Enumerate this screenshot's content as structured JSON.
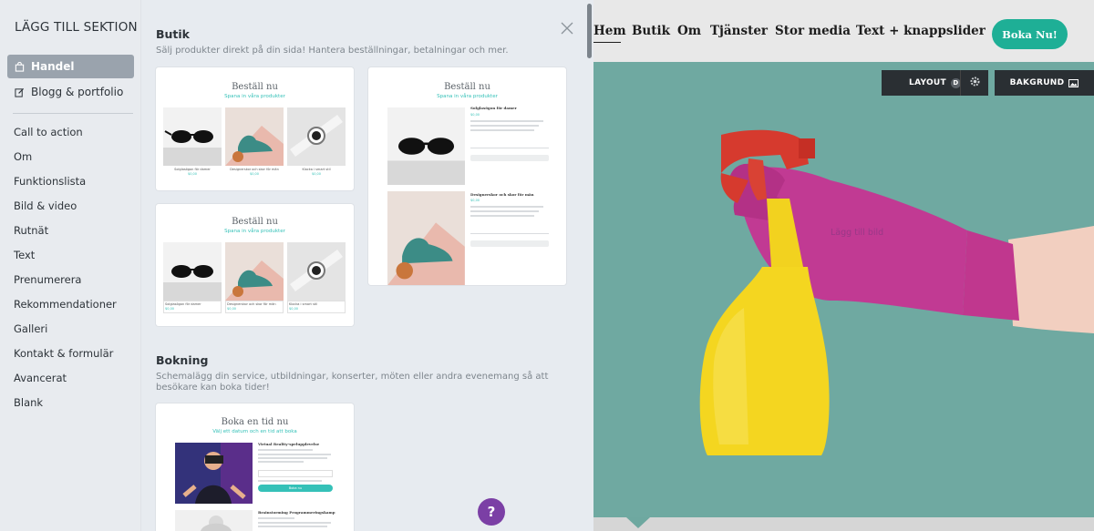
{
  "sidebar": {
    "title": "LÄGG TILL SEKTION",
    "categories": [
      {
        "label": "Handel",
        "icon": "shopping-bag-icon",
        "active": true
      },
      {
        "label": "Blogg & portfolio",
        "icon": "edit-icon",
        "active": false
      }
    ],
    "items": [
      {
        "label": "Call to action"
      },
      {
        "label": "Om"
      },
      {
        "label": "Funktionslista"
      },
      {
        "label": "Bild & video"
      },
      {
        "label": "Rutnät"
      },
      {
        "label": "Text"
      },
      {
        "label": "Prenumerera"
      },
      {
        "label": "Rekommendationer"
      },
      {
        "label": "Galleri"
      },
      {
        "label": "Kontakt & formulär"
      },
      {
        "label": "Avancerat"
      },
      {
        "label": "Blank"
      }
    ]
  },
  "panel": {
    "close_icon": "close-icon",
    "sections": [
      {
        "title": "Butik",
        "description": "Sälj produkter direkt på din sida! Hantera beställningar, betalningar och mer.",
        "templates": [
          {
            "title": "Beställ nu",
            "subtitle": "Spana in våra produkter"
          },
          {
            "title": "Beställ nu",
            "subtitle": "Spana in våra produkter"
          },
          {
            "title": "Beställ nu",
            "subtitle": "Spana in våra produkter"
          }
        ]
      },
      {
        "title": "Bokning",
        "description": "Schemalägg din service, utbildningar, konserter, möten eller andra evenemang så att besökare kan boka tider!",
        "templates": [
          {
            "title": "Boka en tid nu",
            "subtitle": "Välj ett datum och en tid att boka"
          }
        ]
      }
    ],
    "thumb_products": [
      {
        "name": "Solglasögon för damer",
        "price": "$0,00"
      },
      {
        "name": "Designerskor och skor för män",
        "price": "$0,00"
      },
      {
        "name": "Klocka i smart stil",
        "price": "$0,00"
      }
    ],
    "booking_items": [
      {
        "name": "Virtual Reality-spelupplevelse"
      },
      {
        "name": "Brainstorming Programmeringskamp"
      }
    ],
    "booking_button": "Boka nu"
  },
  "preview": {
    "nav": [
      {
        "label": "Hem"
      },
      {
        "label": "Butik"
      },
      {
        "label": "Om"
      },
      {
        "label": "Tjänster"
      },
      {
        "label": "Stor media"
      },
      {
        "label": "Text + knappslider"
      }
    ],
    "cta": "Boka Nu!",
    "layout_button": "LAYOUT",
    "layout_key": "D",
    "background_button": "BAKGRUND",
    "hero_label": "Lägg till bild",
    "help": "?",
    "colors": {
      "accent": "#1eaf96",
      "hero_bg": "#6ea8a0",
      "help": "#7b3fa5"
    }
  }
}
